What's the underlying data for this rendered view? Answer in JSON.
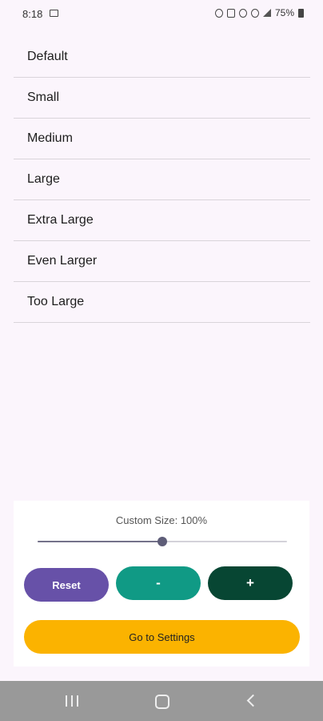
{
  "status_bar": {
    "time": "8:18",
    "battery": "75%"
  },
  "sizes": [
    {
      "label": "Default"
    },
    {
      "label": "Small"
    },
    {
      "label": "Medium"
    },
    {
      "label": "Large"
    },
    {
      "label": "Extra Large"
    },
    {
      "label": "Even Larger"
    },
    {
      "label": "Too Large"
    }
  ],
  "custom": {
    "label": "Custom Size: 100%",
    "slider_fraction": 0.5
  },
  "buttons": {
    "reset": "Reset",
    "minus": "-",
    "plus": "+",
    "settings": "Go to Settings"
  },
  "colors": {
    "reset": "#6751a8",
    "minus": "#109a85",
    "plus": "#074633",
    "settings": "#fbb300"
  }
}
